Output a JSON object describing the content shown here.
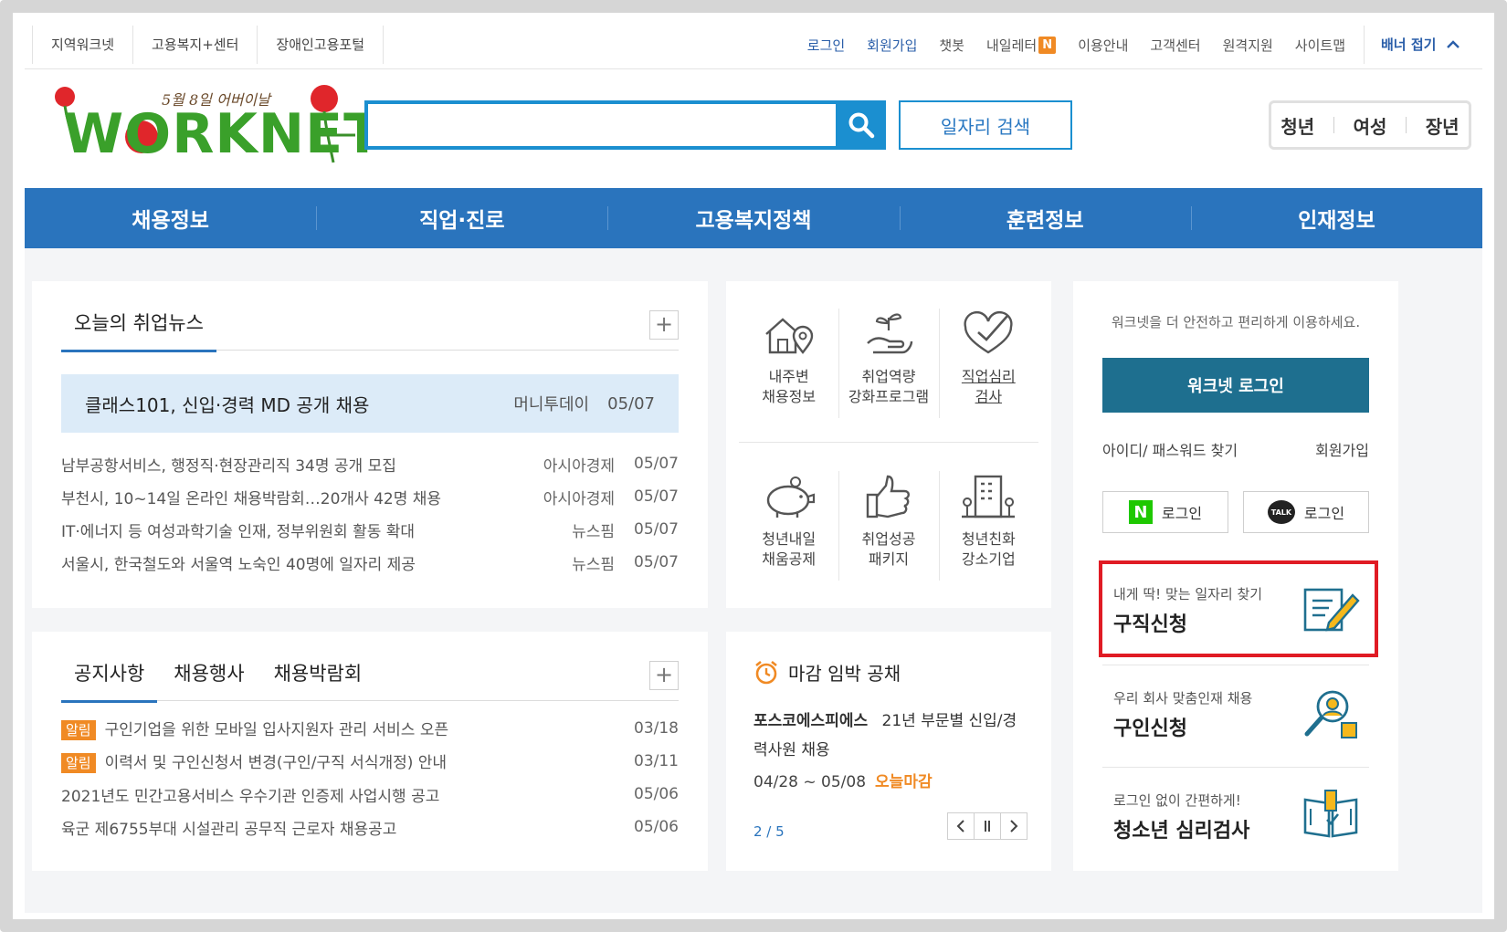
{
  "top_sites": [
    "지역워크넷",
    "고용복지+센터",
    "장애인고용포털"
  ],
  "util_links": [
    {
      "label": "로그인",
      "accent": true
    },
    {
      "label": "회원가입",
      "accent": true
    },
    {
      "label": "챗봇",
      "accent": false
    },
    {
      "label": "내일레터",
      "accent": false,
      "badge": "N"
    },
    {
      "label": "이용안내",
      "accent": false
    },
    {
      "label": "고객센터",
      "accent": false
    },
    {
      "label": "원격지원",
      "accent": false
    },
    {
      "label": "사이트맵",
      "accent": false
    }
  ],
  "banner_fold": "배너 접기",
  "logo": {
    "subtitle": "5월 8일 어버이날",
    "text": "WORKNET"
  },
  "search": {
    "value": "",
    "button": "일자리 검색"
  },
  "age_tabs": [
    "청년",
    "여성",
    "장년"
  ],
  "gnb": [
    "채용정보",
    "직업·진로",
    "고용복지정책",
    "훈련정보",
    "인재정보"
  ],
  "news": {
    "tab": "오늘의 취업뉴스",
    "headline": {
      "title": "클래스101, 신입·경력 MD 공개 채용",
      "source": "머니투데이",
      "date": "05/07"
    },
    "items": [
      {
        "title": "남부공항서비스, 행정직·현장관리직 34명 공개 모집",
        "source": "아시아경제",
        "date": "05/07"
      },
      {
        "title": "부천시, 10~14일 온라인 채용박람회…20개사 42명 채용",
        "source": "아시아경제",
        "date": "05/07"
      },
      {
        "title": "IT·에너지 등 여성과학기술 인재, 정부위원회 활동 확대",
        "source": "뉴스핌",
        "date": "05/07"
      },
      {
        "title": "서울시, 한국철도와 서울역 노숙인 40명에 일자리 제공",
        "source": "뉴스핌",
        "date": "05/07"
      }
    ]
  },
  "quick": [
    {
      "label": "내주변\n채용정보",
      "icon": "house-pin-icon"
    },
    {
      "label": "취업역량\n강화프로그램",
      "icon": "hand-sprout-icon"
    },
    {
      "label": "직업심리\n검사",
      "icon": "heart-check-icon"
    },
    {
      "label": "청년내일\n채움공제",
      "icon": "piggy-bank-icon"
    },
    {
      "label": "취업성공\n패키지",
      "icon": "thumbs-up-icon"
    },
    {
      "label": "청년친화\n강소기업",
      "icon": "building-icon"
    }
  ],
  "notices": {
    "tabs": [
      "공지사항",
      "채용행사",
      "채용박람회"
    ],
    "items": [
      {
        "badge": "알림",
        "title": "구인기업을 위한 모바일 입사지원자 관리 서비스 오픈",
        "date": "03/18"
      },
      {
        "badge": "알림",
        "title": "이력서 및 구인신청서 변경(구인/구직 서식개정) 안내",
        "date": "03/11"
      },
      {
        "badge": "",
        "title": "2021년도 민간고용서비스 우수기관 인증제 사업시행 공고",
        "date": "05/06"
      },
      {
        "badge": "",
        "title": "육군 제6755부대 시설관리 공무직 근로자 채용공고",
        "date": "05/06"
      }
    ]
  },
  "deadline": {
    "title": "마감 임박 공채",
    "company": "포스코에스피에스",
    "desc": "21년 부문별 신입/경력사원 채용",
    "period": "04/28 ~ 05/08",
    "today": "오늘마감",
    "pager": "2 / 5"
  },
  "login": {
    "intro": "워크넷을 더 안전하고 편리하게 이용하세요.",
    "button": "워크넷 로그인",
    "find": "아이디/ 패스워드 찾기",
    "join": "회원가입",
    "naver": "로그인",
    "kakao": "로그인",
    "kakao_icon_text": "TALK",
    "naver_icon_text": "N"
  },
  "services": [
    {
      "small": "내게 딱! 맞는 일자리 찾기",
      "large": "구직신청",
      "icon": "form-pen-icon"
    },
    {
      "small": "우리 회사 맞춤인재 채용",
      "large": "구인신청",
      "icon": "magnifier-person-icon"
    },
    {
      "small": "로그인 없이 간편하게!",
      "large": "청소년 심리검사",
      "icon": "book-check-icon"
    }
  ],
  "colors": {
    "nav": "#2a74bd",
    "accent_blue": "#1b8fd0",
    "login_btn": "#1e6f8f",
    "orange": "#f08a24",
    "highlight": "#e01b24"
  }
}
